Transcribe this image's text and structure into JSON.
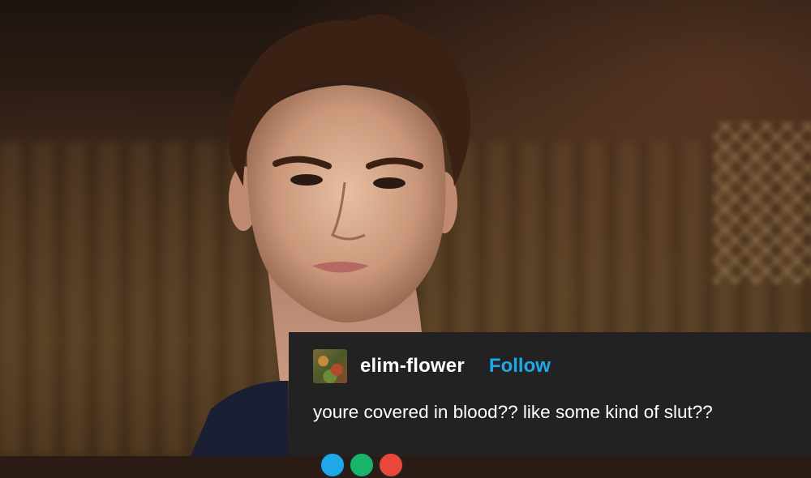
{
  "post": {
    "username": "elim-flower",
    "follow_label": "Follow",
    "text": "youre covered in blood?? like some kind of slut??",
    "reaction_icons": [
      {
        "name": "reblog-icon",
        "color": "#1ea8ea"
      },
      {
        "name": "like-icon",
        "color": "#19b46a"
      },
      {
        "name": "reply-icon",
        "color": "#e8473a"
      }
    ]
  },
  "colors": {
    "post_background": "#222223",
    "follow_blue": "#1ea8ea",
    "text_white": "#ffffff"
  }
}
